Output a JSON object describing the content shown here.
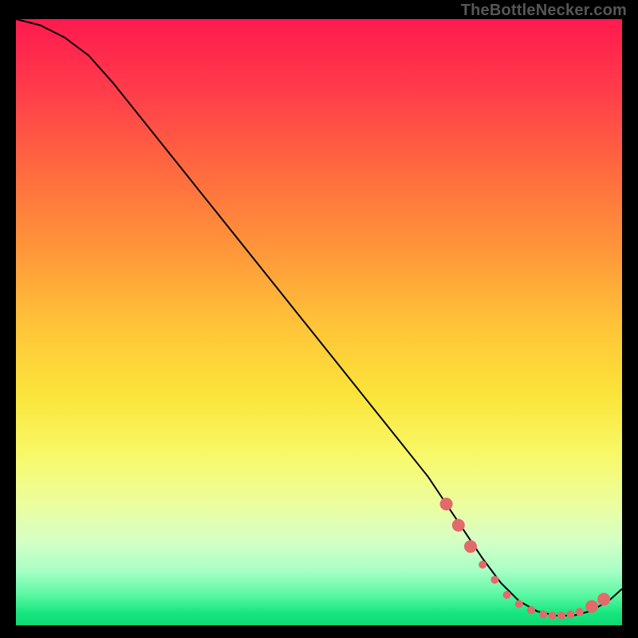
{
  "attribution": "TheBottleNecker.com",
  "chart_data": {
    "type": "line",
    "title": "",
    "xlabel": "",
    "ylabel": "",
    "xlim": [
      0,
      100
    ],
    "ylim": [
      0,
      100
    ],
    "x": [
      0,
      4,
      8,
      12,
      16,
      20,
      24,
      28,
      32,
      36,
      40,
      44,
      48,
      52,
      56,
      60,
      64,
      68,
      71,
      74,
      77,
      80,
      83,
      86,
      89,
      92,
      95,
      98,
      100
    ],
    "values": [
      100,
      99,
      97,
      94,
      89.5,
      84.5,
      79.5,
      74.5,
      69.5,
      64.5,
      59.5,
      54.5,
      49.5,
      44.5,
      39.5,
      34.5,
      29.5,
      24.5,
      20,
      15.5,
      11,
      7,
      4,
      2.3,
      1.6,
      1.6,
      2.4,
      4.2,
      6
    ],
    "markers": {
      "x": [
        71,
        73,
        75,
        77,
        79,
        81,
        83,
        85,
        87,
        88.5,
        90,
        91.5,
        93,
        95,
        97
      ],
      "y": [
        20,
        16.5,
        13,
        10,
        7.5,
        5,
        3.5,
        2.5,
        1.8,
        1.6,
        1.6,
        1.8,
        2.2,
        3.1,
        4.3
      ],
      "color": "#e26a6a",
      "size_small": 5,
      "size_large": 8
    },
    "curve_color": "#000000",
    "curve_width": 2
  }
}
